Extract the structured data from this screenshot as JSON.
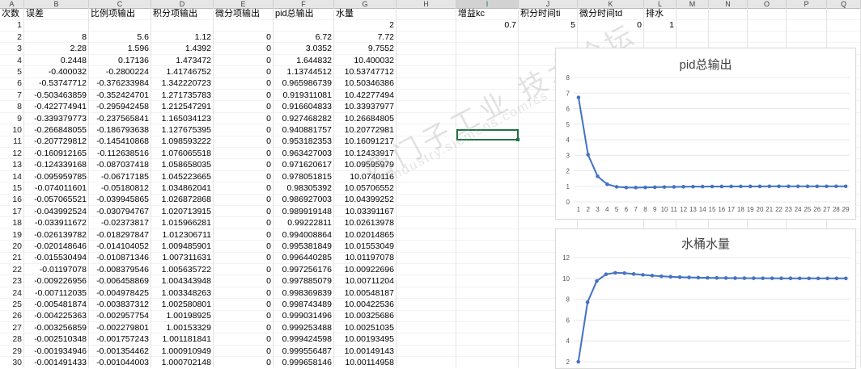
{
  "columns": [
    "A",
    "B",
    "C",
    "D",
    "E",
    "F",
    "G",
    "H",
    "I",
    "J",
    "K",
    "L",
    "M",
    "N",
    "O",
    "P",
    "Q"
  ],
  "selected_column": "I",
  "headers": {
    "A": "次数",
    "B": "误差",
    "C": "比例项输出",
    "D": "积分项输出",
    "E": "微分项输出",
    "F": "pid总输出",
    "G": "水量",
    "I": "增益kc",
    "J": "积分时间ti",
    "K": "微分时间td",
    "L": "排水"
  },
  "params": {
    "I": "0.7",
    "J": "5",
    "K": "0",
    "L": "1"
  },
  "rows": [
    [
      "1",
      "",
      "",
      "",
      "",
      "",
      "2"
    ],
    [
      "2",
      "8",
      "5.6",
      "1.12",
      "0",
      "6.72",
      "7.72"
    ],
    [
      "3",
      "2.28",
      "1.596",
      "1.4392",
      "0",
      "3.0352",
      "9.7552"
    ],
    [
      "4",
      "0.2448",
      "0.17136",
      "1.473472",
      "0",
      "1.644832",
      "10.400032"
    ],
    [
      "5",
      "-0.400032",
      "-0.2800224",
      "1.41746752",
      "0",
      "1.13744512",
      "10.53747712"
    ],
    [
      "6",
      "-0.53747712",
      "-0.376233984",
      "1.342220723",
      "0",
      "0.965986739",
      "10.50346386"
    ],
    [
      "7",
      "-0.503463859",
      "-0.352424701",
      "1.271735783",
      "0",
      "0.919311081",
      "10.42277494"
    ],
    [
      "8",
      "-0.422774941",
      "-0.295942458",
      "1.212547291",
      "0",
      "0.916604833",
      "10.33937977"
    ],
    [
      "9",
      "-0.339379773",
      "-0.237565841",
      "1.165034123",
      "0",
      "0.927468282",
      "10.26684805"
    ],
    [
      "10",
      "-0.266848055",
      "-0.186793638",
      "1.127675395",
      "0",
      "0.940881757",
      "10.20772981"
    ],
    [
      "11",
      "-0.207729812",
      "-0.145410868",
      "1.098593222",
      "0",
      "0.953182353",
      "10.16091217"
    ],
    [
      "12",
      "-0.160912165",
      "-0.112638516",
      "1.076065518",
      "0",
      "0.963427003",
      "10.12433917"
    ],
    [
      "13",
      "-0.124339168",
      "-0.087037418",
      "1.058658035",
      "0",
      "0.971620617",
      "10.09595979"
    ],
    [
      "14",
      "-0.095959785",
      "-0.06717185",
      "1.045223665",
      "0",
      "0.978051815",
      "10.0740116"
    ],
    [
      "15",
      "-0.074011601",
      "-0.05180812",
      "1.034862041",
      "0",
      "0.98305392",
      "10.05706552"
    ],
    [
      "16",
      "-0.057065521",
      "-0.039945865",
      "1.026872868",
      "0",
      "0.986927003",
      "10.04399252"
    ],
    [
      "17",
      "-0.043992524",
      "-0.030794767",
      "1.020713915",
      "0",
      "0.989919148",
      "10.03391167"
    ],
    [
      "18",
      "-0.033911672",
      "-0.02373817",
      "1.015966281",
      "0",
      "0.99222811",
      "10.02613978"
    ],
    [
      "19",
      "-0.026139782",
      "-0.018297847",
      "1.012306711",
      "0",
      "0.994008864",
      "10.02014865"
    ],
    [
      "20",
      "-0.020148646",
      "-0.014104052",
      "1.009485901",
      "0",
      "0.995381849",
      "10.01553049"
    ],
    [
      "21",
      "-0.015530494",
      "-0.010871346",
      "1.007311631",
      "0",
      "0.996440285",
      "10.01197078"
    ],
    [
      "22",
      "-0.01197078",
      "-0.008379546",
      "1.005635722",
      "0",
      "0.997256176",
      "10.00922696"
    ],
    [
      "23",
      "-0.009226956",
      "-0.006458869",
      "1.004343948",
      "0",
      "0.997885079",
      "10.00711204"
    ],
    [
      "24",
      "-0.007112035",
      "-0.004978425",
      "1.003348263",
      "0",
      "0.998369839",
      "10.00548187"
    ],
    [
      "25",
      "-0.005481874",
      "-0.003837312",
      "1.002580801",
      "0",
      "0.998743489",
      "10.00422536"
    ],
    [
      "26",
      "-0.004225363",
      "-0.002957754",
      "1.00198925",
      "0",
      "0.999031496",
      "10.00325686"
    ],
    [
      "27",
      "-0.003256859",
      "-0.002279801",
      "1.00153329",
      "0",
      "0.999253488",
      "10.00251035"
    ],
    [
      "28",
      "-0.002510348",
      "-0.001757243",
      "1.001181841",
      "0",
      "0.999424598",
      "10.00193495"
    ],
    [
      "29",
      "-0.001934946",
      "-0.001354462",
      "1.000910949",
      "0",
      "0.999556487",
      "10.00149143"
    ],
    [
      "30",
      "-0.001491433",
      "-0.001044003",
      "1.000702148",
      "0",
      "0.999658146",
      "10.00114958"
    ]
  ],
  "chart_data": [
    {
      "type": "line",
      "title": "pid总输出",
      "x": [
        1,
        2,
        3,
        4,
        5,
        6,
        7,
        8,
        9,
        10,
        11,
        12,
        13,
        14,
        15,
        16,
        17,
        18,
        19,
        20,
        21,
        22,
        23,
        24,
        25,
        26,
        27,
        28,
        29
      ],
      "ylim": [
        0,
        8
      ],
      "yticks": [
        0,
        1,
        2,
        3,
        4,
        5,
        6,
        7,
        8
      ],
      "series": [
        {
          "values": [
            6.72,
            3.0352,
            1.644832,
            1.13744512,
            0.965986739,
            0.919311081,
            0.916604833,
            0.927468282,
            0.940881757,
            0.953182353,
            0.963427003,
            0.971620617,
            0.978051815,
            0.98305392,
            0.986927003,
            0.989919148,
            0.99222811,
            0.994008864,
            0.995381849,
            0.996440285,
            0.997256176,
            0.997885079,
            0.998369839,
            0.998743489,
            0.999031496,
            0.999253488,
            0.999424598,
            0.999556487,
            0.999658146
          ]
        }
      ],
      "color": "#4472c4",
      "grid": true
    },
    {
      "type": "line",
      "title": "水桶水量",
      "x": [
        1,
        2,
        3,
        4,
        5,
        6,
        7,
        8,
        9,
        10,
        11,
        12,
        13,
        14,
        15,
        16,
        17,
        18,
        19,
        20,
        21,
        22,
        23,
        24,
        25,
        26,
        27,
        28,
        29,
        30
      ],
      "ylim": [
        2,
        12
      ],
      "yticks": [
        2,
        4,
        6,
        8,
        10,
        12
      ],
      "series": [
        {
          "values": [
            2,
            7.72,
            9.7552,
            10.400032,
            10.53747712,
            10.50346386,
            10.42277494,
            10.33937977,
            10.26684805,
            10.20772981,
            10.16091217,
            10.12433917,
            10.09595979,
            10.0740116,
            10.05706552,
            10.04399252,
            10.03391167,
            10.02613978,
            10.02014865,
            10.01553049,
            10.01197078,
            10.00922696,
            10.00711204,
            10.00548187,
            10.00422536,
            10.00325686,
            10.00251035,
            10.00193495,
            10.00149143,
            10.00114958
          ]
        }
      ],
      "color": "#4472c4",
      "grid": true
    }
  ],
  "watermark": "西门子工业 技术论坛",
  "watermark_url": "industry.siemens.com/cs"
}
